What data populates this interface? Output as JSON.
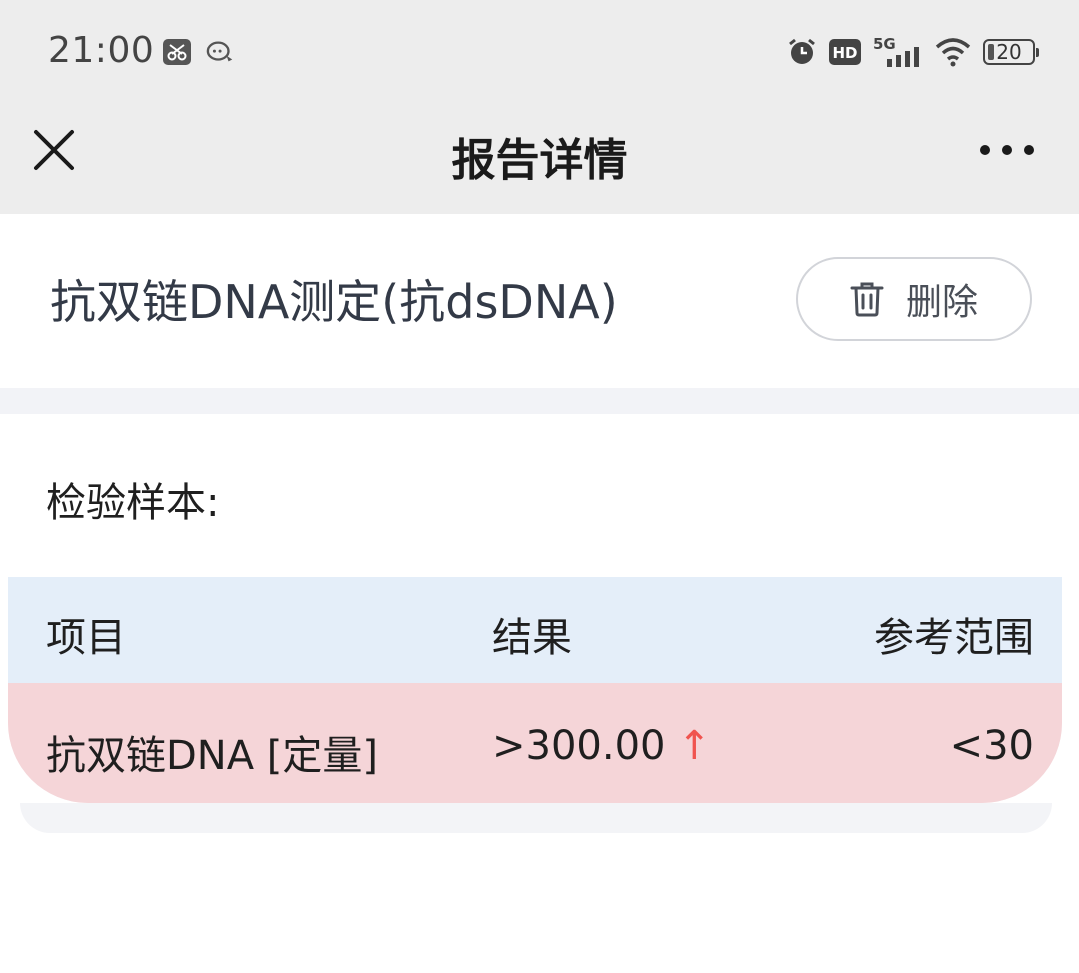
{
  "status_bar": {
    "time": "21:00",
    "network": "5G",
    "hd": "HD",
    "battery": "20"
  },
  "nav": {
    "title": "报告详情"
  },
  "report": {
    "name": "抗双链DNA测定(抗dsDNA)",
    "delete_label": "删除"
  },
  "sample": {
    "label": "检验样本:"
  },
  "table": {
    "headers": {
      "item": "项目",
      "result": "结果",
      "range": "参考范围"
    },
    "rows": [
      {
        "item": "抗双链DNA [定量]",
        "result": ">300.00",
        "flag": "↑",
        "range": "<30"
      }
    ]
  },
  "colors": {
    "abnormal_row": "#f5d5d8",
    "header_row": "#e4eef9",
    "up_arrow": "#f0544f"
  }
}
